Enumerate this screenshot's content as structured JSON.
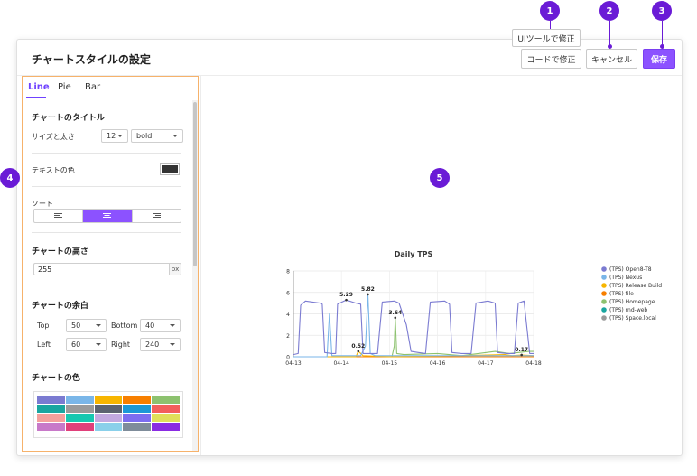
{
  "dialog": {
    "title": "チャートスタイルの設定",
    "buttons": {
      "edit_code": "コードで修正",
      "cancel": "キャンセル",
      "save": "保存"
    },
    "ui_tool": "UIツールで修正"
  },
  "markers": [
    "1",
    "2",
    "3",
    "4",
    "5"
  ],
  "left": {
    "tabs": [
      "Line",
      "Pie",
      "Bar"
    ],
    "active_tab": "Line",
    "title_section": "チャートのタイトル",
    "size_weight_label": "サイズと太さ",
    "font_size": "12",
    "font_weight": "bold",
    "text_color_label": "テキストの色",
    "text_color": "#333333",
    "sort_label": "ソート",
    "sort_active": "center",
    "height_section": "チャートの高さ",
    "height_value": "255",
    "height_unit": "px",
    "margin_section": "チャートの余白",
    "margins": {
      "top_label": "Top",
      "top": "50",
      "bottom_label": "Bottom",
      "bottom": "40",
      "left_label": "Left",
      "left": "60",
      "right_label": "Right",
      "right": "240"
    },
    "color_section": "チャートの色",
    "palette": [
      [
        "#7b7bd1",
        "#7ab6e8",
        "#f7b500",
        "#f77f00",
        "#8dc26f"
      ],
      [
        "#1aa6a0",
        "#9a9a9a",
        "#5c6370",
        "#1b98d6",
        "#f25f5c"
      ],
      [
        "#f4a09c",
        "#17c8b0",
        "#c3a9e0",
        "#7c6df0",
        "#e0e05a"
      ],
      [
        "#c879c9",
        "#e0407a",
        "#8ad0ea",
        "#7f8c9a",
        "#8a2be2"
      ]
    ]
  },
  "chart_data": {
    "type": "line",
    "title": "Daily TPS",
    "x_ticks": [
      "04-13",
      "04-14",
      "04-15",
      "04-16",
      "04-17",
      "04-18"
    ],
    "y_ticks": [
      "0",
      "2",
      "4",
      "6",
      "8"
    ],
    "ylim": [
      0,
      8
    ],
    "grid": true,
    "legend_position": "right",
    "series": [
      {
        "name": "(TPS) Open8-T8",
        "color": "#7b7bd1",
        "points": [
          [
            0,
            0.2
          ],
          [
            0.1,
            0.3
          ],
          [
            0.15,
            4.8
          ],
          [
            0.25,
            5.2
          ],
          [
            0.55,
            5.0
          ],
          [
            0.6,
            4.9
          ],
          [
            0.65,
            0.4
          ],
          [
            0.8,
            0.3
          ],
          [
            0.88,
            0.3
          ],
          [
            0.92,
            4.9
          ],
          [
            1.1,
            5.29
          ],
          [
            1.3,
            5.0
          ],
          [
            1.4,
            4.9
          ],
          [
            1.45,
            0.3
          ],
          [
            1.6,
            0.3
          ],
          [
            1.75,
            0.3
          ],
          [
            1.85,
            5.1
          ],
          [
            2.1,
            5.2
          ],
          [
            2.2,
            5.0
          ],
          [
            2.35,
            3.0
          ],
          [
            2.45,
            0.5
          ],
          [
            2.6,
            0.4
          ],
          [
            2.75,
            0.3
          ],
          [
            2.85,
            5.1
          ],
          [
            3.15,
            5.2
          ],
          [
            3.25,
            4.9
          ],
          [
            3.3,
            0.4
          ],
          [
            3.5,
            0.3
          ],
          [
            3.7,
            0.3
          ],
          [
            3.8,
            5.0
          ],
          [
            4.05,
            5.2
          ],
          [
            4.2,
            5.0
          ],
          [
            4.25,
            0.4
          ],
          [
            4.45,
            0.3
          ],
          [
            4.6,
            0.3
          ],
          [
            4.68,
            5.0
          ],
          [
            4.8,
            5.2
          ],
          [
            4.92,
            0.3
          ],
          [
            5,
            0.3
          ]
        ]
      },
      {
        "name": "(TPS) Nexus",
        "color": "#7ab6e8",
        "points": [
          [
            0,
            0
          ],
          [
            0.7,
            0
          ],
          [
            0.75,
            4.0
          ],
          [
            0.8,
            0.1
          ],
          [
            1.4,
            0.1
          ],
          [
            1.5,
            1.0
          ],
          [
            1.55,
            5.82
          ],
          [
            1.6,
            0.3
          ],
          [
            1.7,
            0.1
          ],
          [
            5,
            0.1
          ]
        ]
      },
      {
        "name": "(TPS) Release Build",
        "color": "#f7b500",
        "points": [
          [
            0,
            0
          ],
          [
            1.3,
            0
          ],
          [
            1.35,
            0.52
          ],
          [
            1.45,
            0.1
          ],
          [
            2.0,
            0
          ],
          [
            3.5,
            0.1
          ],
          [
            4.4,
            0.2
          ],
          [
            4.55,
            0.1
          ],
          [
            4.75,
            0.17
          ],
          [
            5,
            0.1
          ]
        ]
      },
      {
        "name": "(TPS) file",
        "color": "#f77f00",
        "points": [
          [
            0,
            0
          ],
          [
            5,
            0
          ]
        ]
      },
      {
        "name": "(TPS) Homepage",
        "color": "#8dc26f",
        "points": [
          [
            0,
            0
          ],
          [
            2.05,
            0
          ],
          [
            2.1,
            1.0
          ],
          [
            2.12,
            3.64
          ],
          [
            2.15,
            0.3
          ],
          [
            2.3,
            0.2
          ],
          [
            3.0,
            0.3
          ],
          [
            3.5,
            0.1
          ],
          [
            4.2,
            0.5
          ],
          [
            4.5,
            0.3
          ],
          [
            4.9,
            0.5
          ],
          [
            5,
            0.5
          ]
        ]
      },
      {
        "name": "(TPS) rnd-web",
        "color": "#1aa6a0",
        "points": [
          [
            0,
            0
          ],
          [
            5,
            0
          ]
        ]
      },
      {
        "name": "(TPS) Space.local",
        "color": "#9a9a9a",
        "points": [
          [
            0,
            0
          ],
          [
            5,
            0
          ]
        ]
      }
    ],
    "annotations": [
      {
        "label": "5.29",
        "x": 1.1,
        "y": 5.29
      },
      {
        "label": "5.82",
        "x": 1.55,
        "y": 5.82
      },
      {
        "label": "3.64",
        "x": 2.12,
        "y": 3.64
      },
      {
        "label": "0.52",
        "x": 1.35,
        "y": 0.52
      },
      {
        "label": "0.17",
        "x": 4.75,
        "y": 0.17
      }
    ]
  }
}
